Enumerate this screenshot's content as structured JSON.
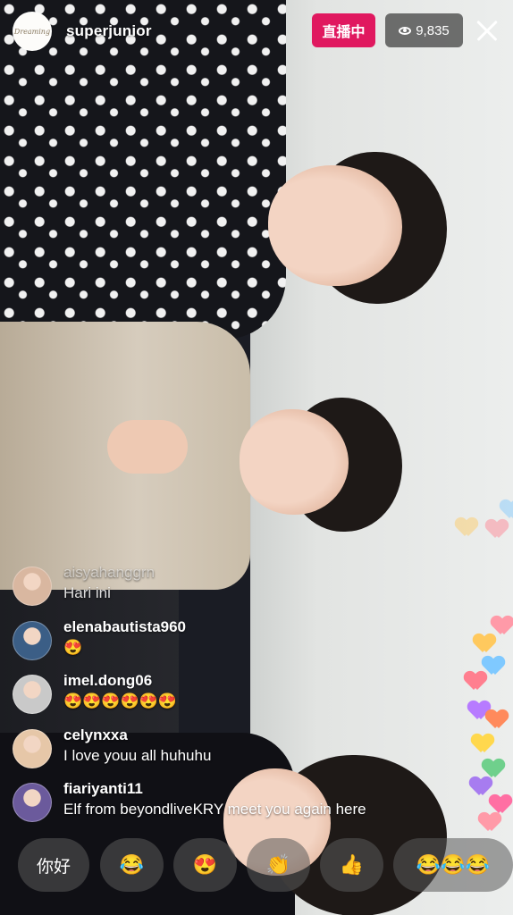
{
  "header": {
    "host_avatar_text": "Dreaming",
    "host_name": "superjunior",
    "live_label": "直播中",
    "viewer_count": "9,835"
  },
  "comments": [
    {
      "user": "aisyahanggrn",
      "message": "Hari ini",
      "avatar_color": "#d9b7a0",
      "faded": true
    },
    {
      "user": "elenabautista960",
      "message": "😍",
      "avatar_color": "#3b5e86",
      "faded": false
    },
    {
      "user": "imel.dong06",
      "message": "😍😍😍😍😍😍",
      "avatar_color": "#c9c9c9",
      "faded": false
    },
    {
      "user": "celynxxa",
      "message": "I love youu all huhuhu",
      "avatar_color": "#e6c7a8",
      "faded": false
    },
    {
      "user": "fiariyanti11",
      "message": "Elf from beyondliveKRY meet you again here",
      "avatar_color": "#6b5a9c",
      "faded": false
    }
  ],
  "quick_replies": [
    {
      "label": "你好",
      "type": "text"
    },
    {
      "label": "😂",
      "type": "emoji"
    },
    {
      "label": "😍",
      "type": "emoji"
    },
    {
      "label": "👏",
      "type": "emoji"
    },
    {
      "label": "👍",
      "type": "emoji"
    },
    {
      "label": "😂😂😂",
      "type": "emoji"
    }
  ],
  "heart_colors": [
    "#ff9aa8",
    "#ffc95e",
    "#ff7f8f",
    "#7fc9ff",
    "#b77bff",
    "#ff8a5c",
    "#ffd84d",
    "#6fd08c",
    "#a77cf0",
    "#ff6fa3"
  ]
}
